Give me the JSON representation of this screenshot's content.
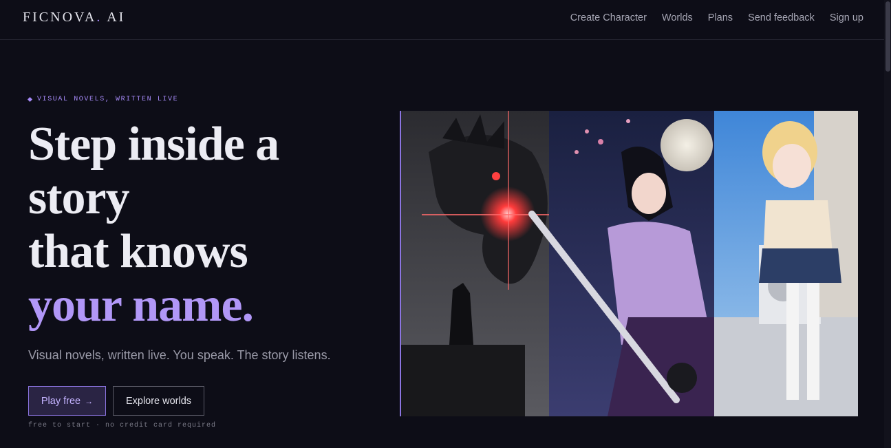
{
  "header": {
    "brand_name": "FICNOVA",
    "brand_dot": ".",
    "brand_suffix": " AI",
    "nav": [
      {
        "label": "Create Character"
      },
      {
        "label": "Worlds"
      },
      {
        "label": "Plans"
      },
      {
        "label": "Send feedback"
      },
      {
        "label": "Sign up"
      }
    ]
  },
  "hero": {
    "eyebrow": "VISUAL NOVELS, WRITTEN LIVE",
    "headline": {
      "line1": "Step inside a",
      "line2": "story",
      "line3": "that knows",
      "line4": "your name."
    },
    "subtitle": "Visual novels, written live. You speak. The story listens.",
    "primary_cta": "Play free",
    "primary_cta_arrow": "→",
    "secondary_cta": "Explore worlds",
    "fineprint": "free to start · no credit card required"
  },
  "colors": {
    "background": "#0d0d17",
    "accent": "#a78bfa",
    "headline_accent": "#b197f7"
  }
}
